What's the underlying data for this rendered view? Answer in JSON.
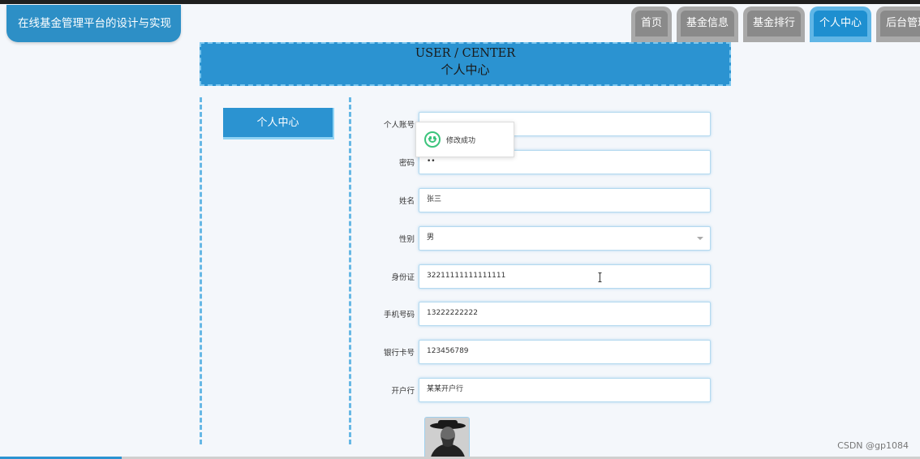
{
  "header": {
    "site_title": "在线基金管理平台的设计与实现",
    "nav_tabs": [
      {
        "label": "首页",
        "active": false
      },
      {
        "label": "基金信息",
        "active": false
      },
      {
        "label": "基金排行",
        "active": false
      },
      {
        "label": "个人中心",
        "active": true
      },
      {
        "label": "后台管理",
        "active": false
      }
    ]
  },
  "banner": {
    "title_en": "USER / CENTER",
    "title_cn": "个人中心"
  },
  "sidebar": {
    "button_label": "个人中心"
  },
  "form": {
    "fields": [
      {
        "label": "个人账号",
        "value": ""
      },
      {
        "label": "密码",
        "value": "••"
      },
      {
        "label": "姓名",
        "value": "张三"
      },
      {
        "label": "性别",
        "value": "男"
      },
      {
        "label": "身份证",
        "value": "32211111111111111"
      },
      {
        "label": "手机号码",
        "value": "13222222222"
      },
      {
        "label": "银行卡号",
        "value": "123456789"
      },
      {
        "label": "开户行",
        "value": "某某开户行"
      }
    ]
  },
  "toast": {
    "message": "修改成功",
    "icon": "smile-icon"
  },
  "watermark": "CSDN @gp1084",
  "colors": {
    "primary": "#2b93d1",
    "active_tab": "#1e8fd0",
    "inactive_tab": "#8a8a8a",
    "success": "#3cc47c"
  }
}
